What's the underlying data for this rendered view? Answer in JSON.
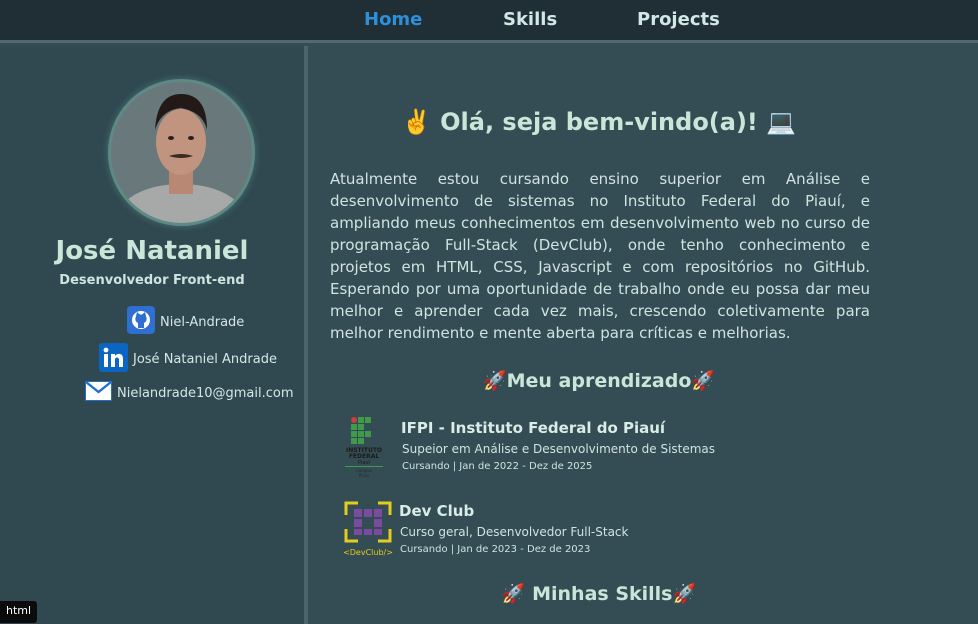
{
  "nav": {
    "items": [
      {
        "label": "Home",
        "active": true
      },
      {
        "label": "Skills",
        "active": false
      },
      {
        "label": "Projects",
        "active": false
      }
    ]
  },
  "profile": {
    "name": "José Nataniel",
    "role": "Desenvolvedor Front-end",
    "contacts": [
      {
        "icon": "github-icon",
        "label": "Niel-Andrade"
      },
      {
        "icon": "linkedin-icon",
        "label": "José Nataniel Andrade"
      },
      {
        "icon": "mail-icon",
        "label": "Nielandrade10@gmail.com"
      }
    ]
  },
  "main": {
    "title": "✌️ Olá, seja bem-vindo(a)! 💻",
    "intro": "Atualmente estou cursando ensino superior em Análise e desenvolvimento de sistemas no Instituto Federal do Piauí, e ampliando meus conhecimentos em desenvolvimento web no curso de programação Full-Stack (DevClub), onde tenho conhecimento e projetos em HTML, CSS, Javascript e com repositórios no GitHub. Esperando por uma oportunidade de trabalho onde eu possa dar meu melhor e aprender cada vez mais, crescendo coletivamente para melhor rendimento e mente aberta para críticas e melhorias.",
    "learning_title": "🚀Meu aprendizado🚀",
    "education": [
      {
        "title": "IFPI - Instituto Federal do Piauí",
        "subtitle": "Supeior em Análise e Desenvolvimento de Sistemas",
        "dates": "Cursando | Jan de 2022 - Dez de 2025",
        "logo_text": [
          "INSTITUTO",
          "FEDERAL",
          "Piauí",
          "Campus",
          "Picos"
        ]
      },
      {
        "title": "Dev Club",
        "subtitle": "Curso geral, Desenvolvedor Full-Stack",
        "dates": "Cursando | Jan de 2023 - Dez de 2023",
        "logo_text": "<DevClub/>"
      }
    ],
    "skills_title": "🚀 Minhas Skills🚀"
  },
  "tooltip": "html",
  "colors": {
    "nav_bg": "#1f2f35",
    "active": "#2f8fd8",
    "sidebar_bg": "#304850",
    "main_bg": "#344d54",
    "text": "#d3e8e6"
  }
}
